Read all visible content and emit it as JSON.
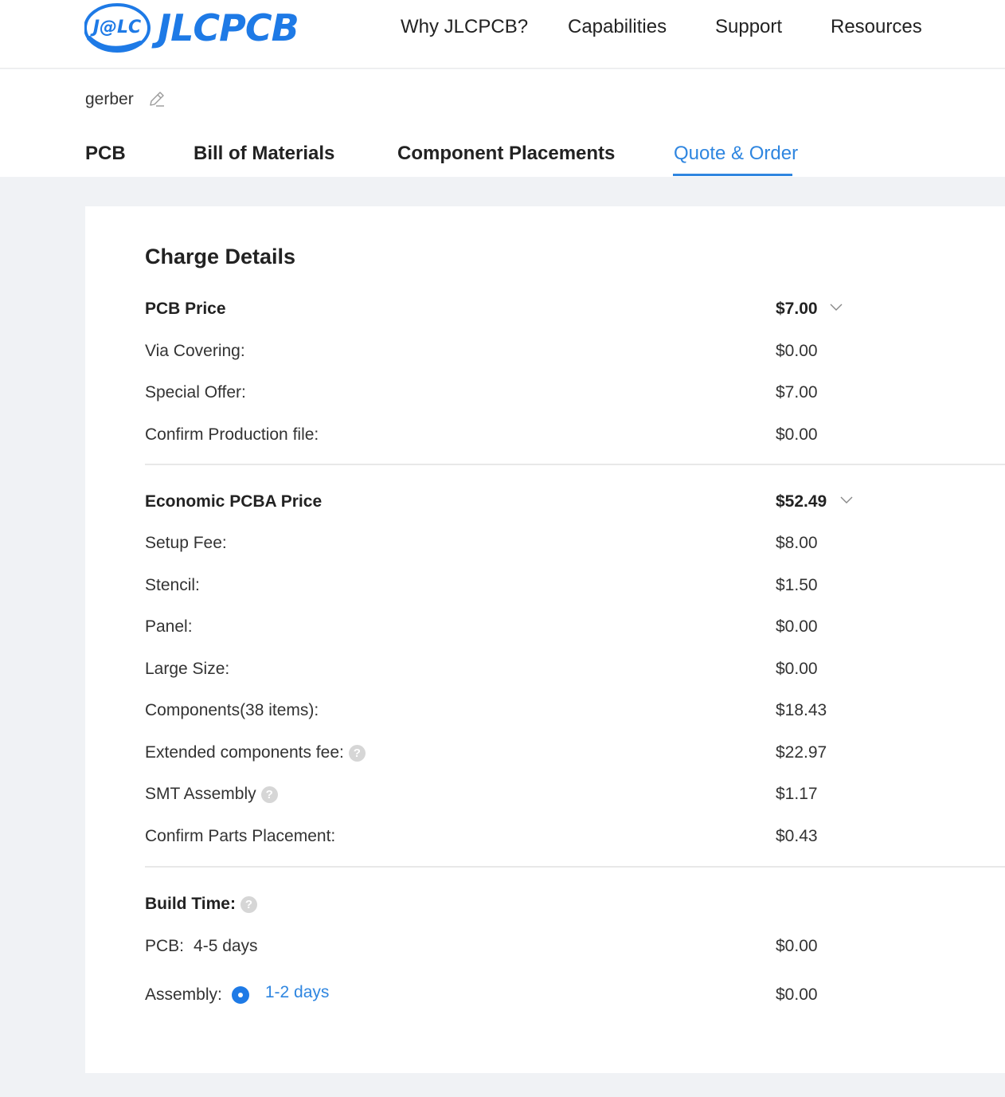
{
  "header": {
    "logo_mark": "J@LC",
    "logo_text": "JLCPCB",
    "nav": [
      "Why JLCPCB?",
      "Capabilities",
      "Support",
      "Resources"
    ]
  },
  "file": {
    "name": "gerber"
  },
  "tabs": [
    {
      "label": "PCB",
      "active": false
    },
    {
      "label": "Bill of Materials",
      "active": false
    },
    {
      "label": "Component Placements",
      "active": false
    },
    {
      "label": "Quote & Order",
      "active": true
    }
  ],
  "charge": {
    "title": "Charge Details",
    "pcb": {
      "label": "PCB Price",
      "total": "$7.00",
      "items": [
        {
          "label": "Via Covering:",
          "value": "$0.00"
        },
        {
          "label": "Special Offer:",
          "value": "$7.00"
        },
        {
          "label": "Confirm Production file:",
          "value": "$0.00"
        }
      ]
    },
    "pcba": {
      "label": "Economic PCBA Price",
      "total": "$52.49",
      "items": [
        {
          "label": "Setup Fee:",
          "value": "$8.00"
        },
        {
          "label": "Stencil:",
          "value": "$1.50"
        },
        {
          "label": "Panel:",
          "value": "$0.00"
        },
        {
          "label": "Large Size:",
          "value": "$0.00"
        },
        {
          "label": "Components(38 items):",
          "value": "$18.43"
        },
        {
          "label": "Extended components fee:",
          "value": "$22.97",
          "help": true
        },
        {
          "label": "SMT Assembly",
          "value": "$1.17",
          "help": true
        },
        {
          "label": "Confirm Parts Placement:",
          "value": "$0.43"
        }
      ]
    },
    "build": {
      "label": "Build Time:",
      "pcb_label": "PCB:",
      "pcb_time": "4-5 days",
      "pcb_value": "$0.00",
      "assembly_label": "Assembly:",
      "assembly_option": "1-2 days",
      "assembly_value": "$0.00"
    }
  },
  "colors": {
    "accent": "#2f86e0",
    "brand": "#1e7ae6",
    "page_bg": "#f0f2f5"
  }
}
